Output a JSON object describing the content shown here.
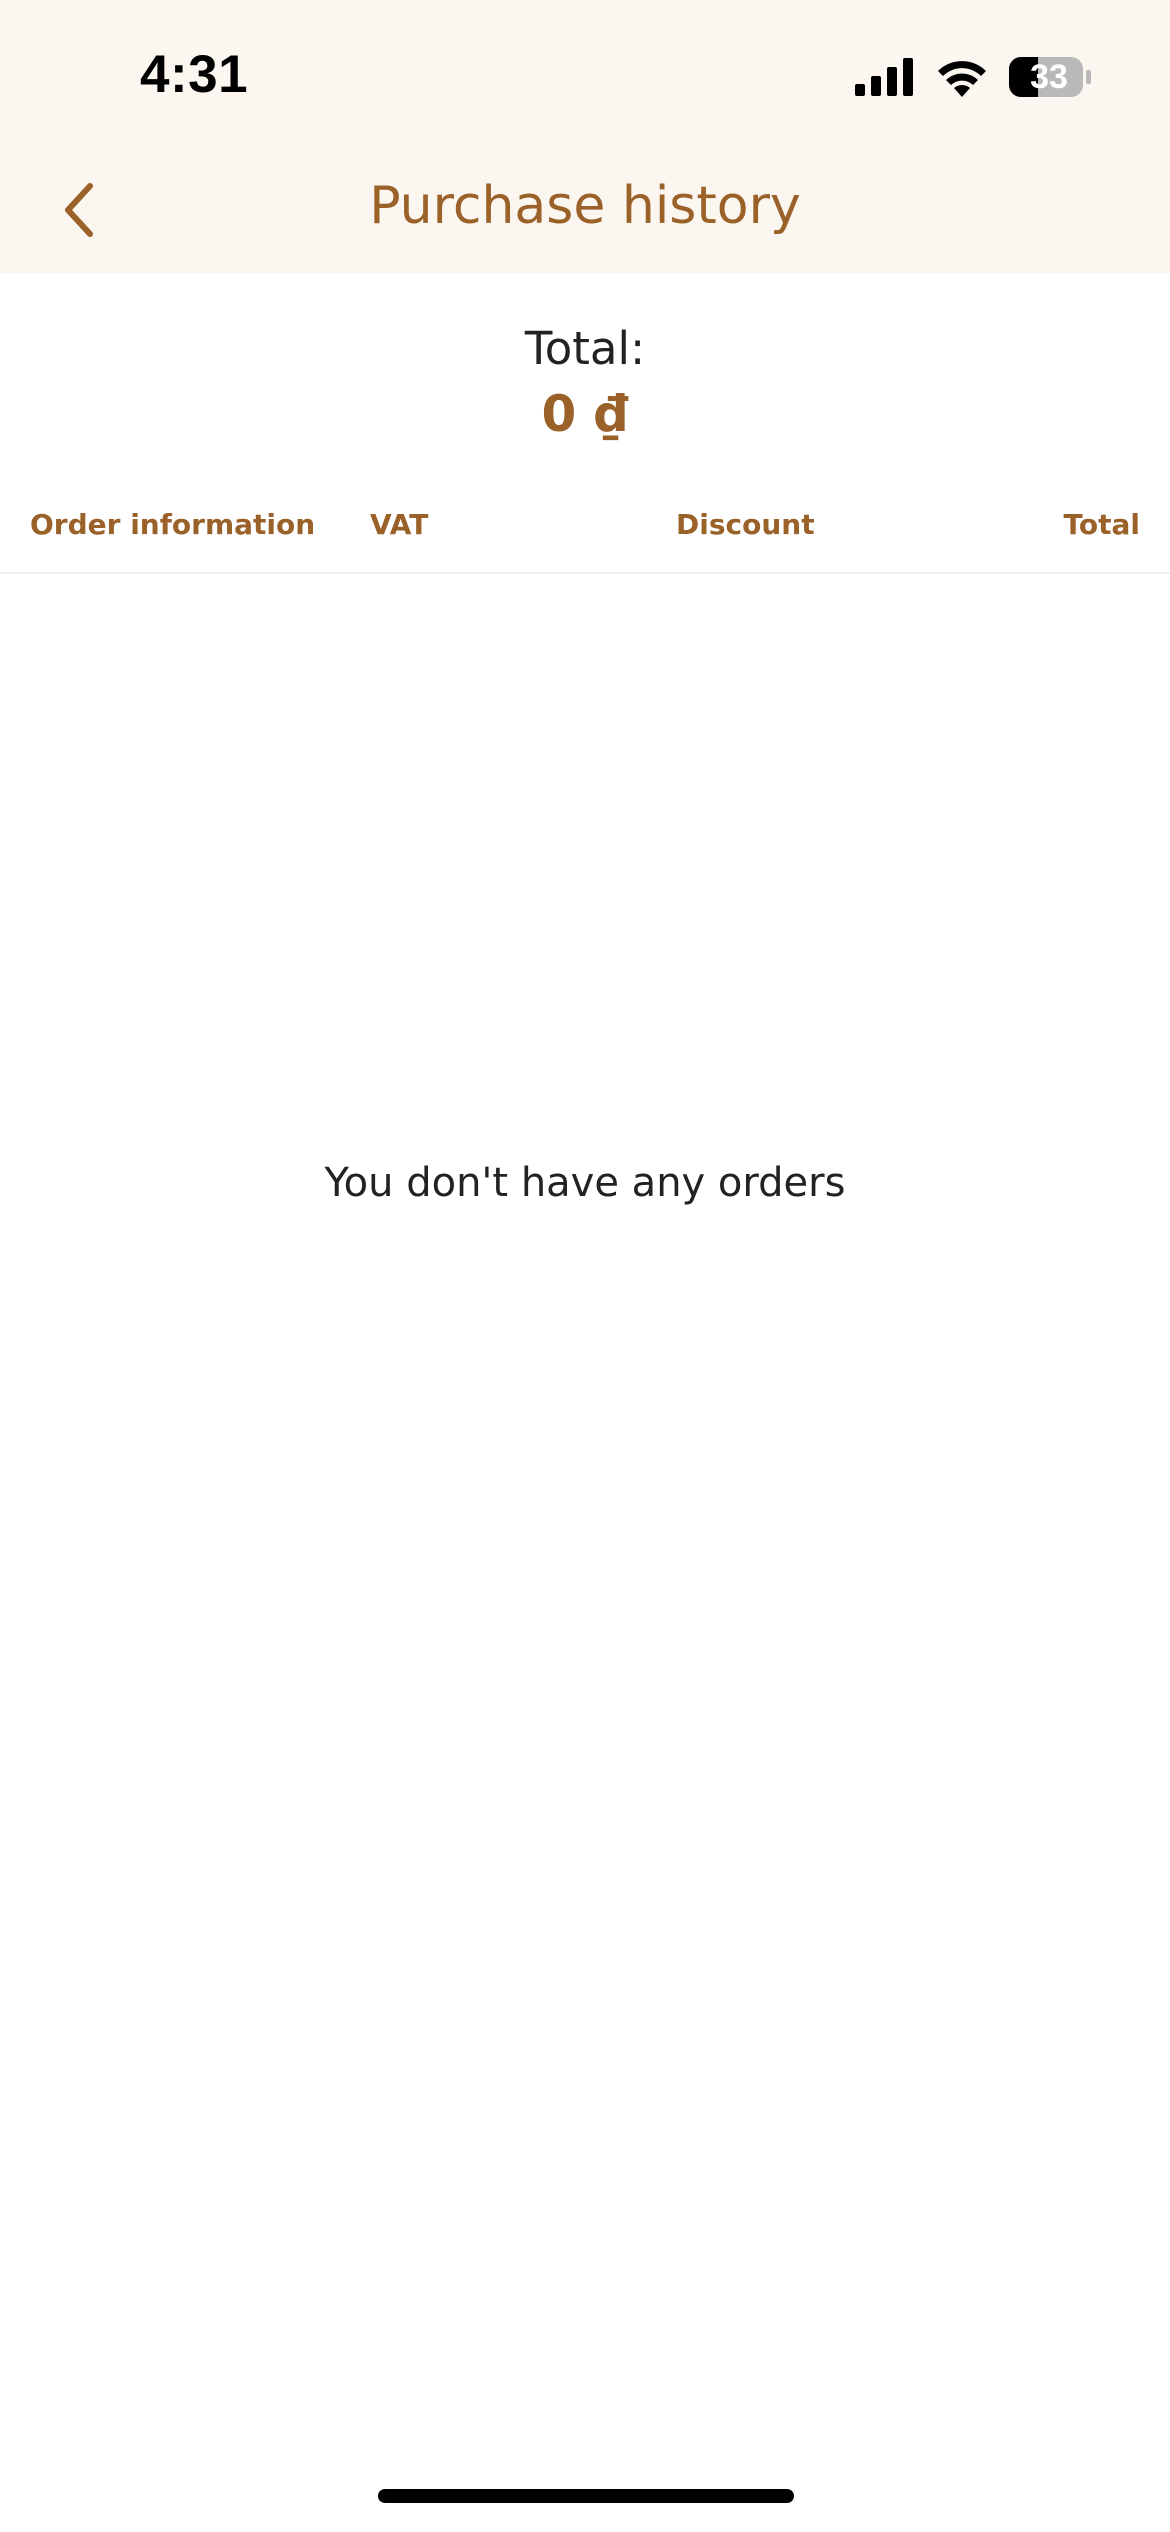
{
  "status_bar": {
    "time": "4:31",
    "battery_level": "33",
    "icons": [
      "signal-icon",
      "wifi-icon",
      "battery-icon"
    ]
  },
  "nav": {
    "title": "Purchase history",
    "back_icon": "chevron-left-icon"
  },
  "summary": {
    "label": "Total:",
    "value": "0 ₫"
  },
  "table": {
    "columns": [
      "Order information",
      "VAT",
      "Discount",
      "Total"
    ]
  },
  "empty_state": {
    "message": "You don't have any orders"
  },
  "colors": {
    "accent": "#9a6128",
    "header_bg": "#fbf6f0",
    "text": "#222222"
  }
}
